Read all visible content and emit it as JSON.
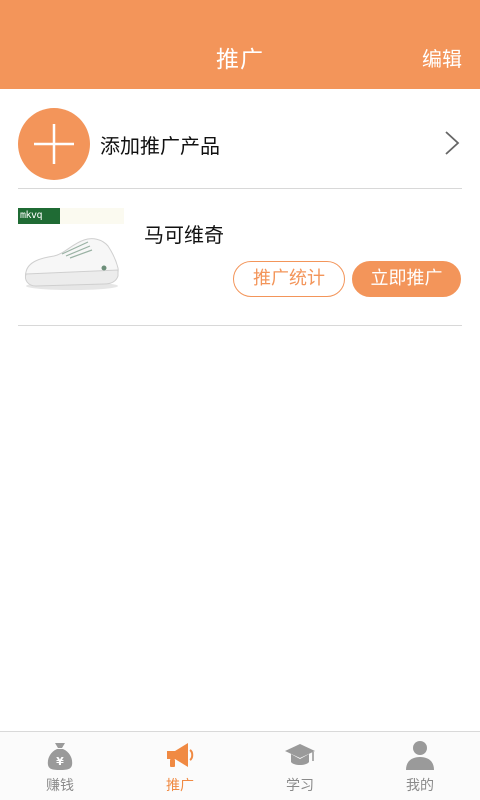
{
  "header": {
    "title": "推广",
    "edit_label": "编辑"
  },
  "add_product": {
    "label": "添加推广产品",
    "icon": "plus-icon",
    "chevron_icon": "chevron-right-icon"
  },
  "products": [
    {
      "name": "马可维奇",
      "brand_logo": "mkvq",
      "stats_button": "推广统计",
      "promote_button": "立即推广"
    }
  ],
  "tabbar": {
    "items": [
      {
        "label": "赚钱",
        "icon": "money-bag-icon",
        "active": false
      },
      {
        "label": "推广",
        "icon": "megaphone-icon",
        "active": true
      },
      {
        "label": "学习",
        "icon": "graduation-cap-icon",
        "active": false
      },
      {
        "label": "我的",
        "icon": "user-icon",
        "active": false
      }
    ]
  },
  "colors": {
    "accent": "#f3955a",
    "tab_inactive": "#8a8a8a",
    "divider": "#d8d8d8"
  }
}
